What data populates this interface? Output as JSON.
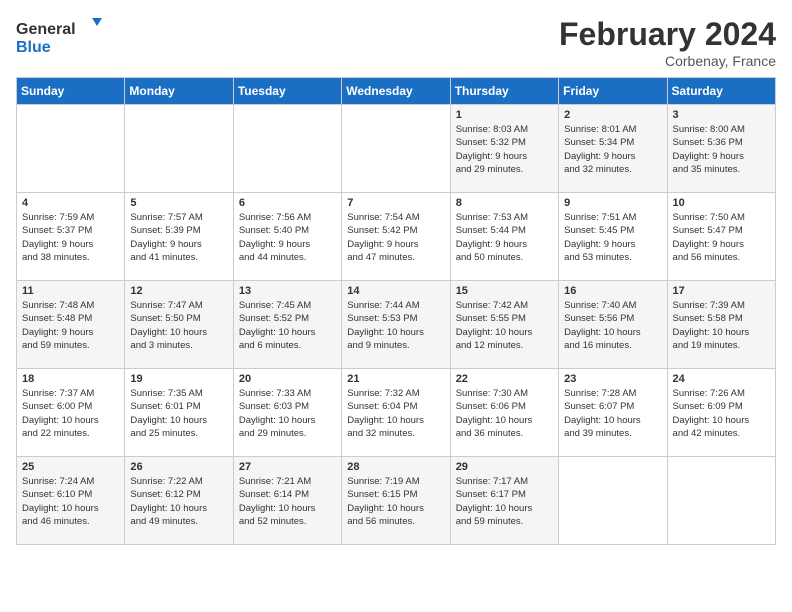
{
  "header": {
    "logo_general": "General",
    "logo_blue": "Blue",
    "month_title": "February 2024",
    "location": "Corbenay, France"
  },
  "days_of_week": [
    "Sunday",
    "Monday",
    "Tuesday",
    "Wednesday",
    "Thursday",
    "Friday",
    "Saturday"
  ],
  "weeks": [
    [
      {
        "day": "",
        "info": ""
      },
      {
        "day": "",
        "info": ""
      },
      {
        "day": "",
        "info": ""
      },
      {
        "day": "",
        "info": ""
      },
      {
        "day": "1",
        "info": "Sunrise: 8:03 AM\nSunset: 5:32 PM\nDaylight: 9 hours\nand 29 minutes."
      },
      {
        "day": "2",
        "info": "Sunrise: 8:01 AM\nSunset: 5:34 PM\nDaylight: 9 hours\nand 32 minutes."
      },
      {
        "day": "3",
        "info": "Sunrise: 8:00 AM\nSunset: 5:36 PM\nDaylight: 9 hours\nand 35 minutes."
      }
    ],
    [
      {
        "day": "4",
        "info": "Sunrise: 7:59 AM\nSunset: 5:37 PM\nDaylight: 9 hours\nand 38 minutes."
      },
      {
        "day": "5",
        "info": "Sunrise: 7:57 AM\nSunset: 5:39 PM\nDaylight: 9 hours\nand 41 minutes."
      },
      {
        "day": "6",
        "info": "Sunrise: 7:56 AM\nSunset: 5:40 PM\nDaylight: 9 hours\nand 44 minutes."
      },
      {
        "day": "7",
        "info": "Sunrise: 7:54 AM\nSunset: 5:42 PM\nDaylight: 9 hours\nand 47 minutes."
      },
      {
        "day": "8",
        "info": "Sunrise: 7:53 AM\nSunset: 5:44 PM\nDaylight: 9 hours\nand 50 minutes."
      },
      {
        "day": "9",
        "info": "Sunrise: 7:51 AM\nSunset: 5:45 PM\nDaylight: 9 hours\nand 53 minutes."
      },
      {
        "day": "10",
        "info": "Sunrise: 7:50 AM\nSunset: 5:47 PM\nDaylight: 9 hours\nand 56 minutes."
      }
    ],
    [
      {
        "day": "11",
        "info": "Sunrise: 7:48 AM\nSunset: 5:48 PM\nDaylight: 9 hours\nand 59 minutes."
      },
      {
        "day": "12",
        "info": "Sunrise: 7:47 AM\nSunset: 5:50 PM\nDaylight: 10 hours\nand 3 minutes."
      },
      {
        "day": "13",
        "info": "Sunrise: 7:45 AM\nSunset: 5:52 PM\nDaylight: 10 hours\nand 6 minutes."
      },
      {
        "day": "14",
        "info": "Sunrise: 7:44 AM\nSunset: 5:53 PM\nDaylight: 10 hours\nand 9 minutes."
      },
      {
        "day": "15",
        "info": "Sunrise: 7:42 AM\nSunset: 5:55 PM\nDaylight: 10 hours\nand 12 minutes."
      },
      {
        "day": "16",
        "info": "Sunrise: 7:40 AM\nSunset: 5:56 PM\nDaylight: 10 hours\nand 16 minutes."
      },
      {
        "day": "17",
        "info": "Sunrise: 7:39 AM\nSunset: 5:58 PM\nDaylight: 10 hours\nand 19 minutes."
      }
    ],
    [
      {
        "day": "18",
        "info": "Sunrise: 7:37 AM\nSunset: 6:00 PM\nDaylight: 10 hours\nand 22 minutes."
      },
      {
        "day": "19",
        "info": "Sunrise: 7:35 AM\nSunset: 6:01 PM\nDaylight: 10 hours\nand 25 minutes."
      },
      {
        "day": "20",
        "info": "Sunrise: 7:33 AM\nSunset: 6:03 PM\nDaylight: 10 hours\nand 29 minutes."
      },
      {
        "day": "21",
        "info": "Sunrise: 7:32 AM\nSunset: 6:04 PM\nDaylight: 10 hours\nand 32 minutes."
      },
      {
        "day": "22",
        "info": "Sunrise: 7:30 AM\nSunset: 6:06 PM\nDaylight: 10 hours\nand 36 minutes."
      },
      {
        "day": "23",
        "info": "Sunrise: 7:28 AM\nSunset: 6:07 PM\nDaylight: 10 hours\nand 39 minutes."
      },
      {
        "day": "24",
        "info": "Sunrise: 7:26 AM\nSunset: 6:09 PM\nDaylight: 10 hours\nand 42 minutes."
      }
    ],
    [
      {
        "day": "25",
        "info": "Sunrise: 7:24 AM\nSunset: 6:10 PM\nDaylight: 10 hours\nand 46 minutes."
      },
      {
        "day": "26",
        "info": "Sunrise: 7:22 AM\nSunset: 6:12 PM\nDaylight: 10 hours\nand 49 minutes."
      },
      {
        "day": "27",
        "info": "Sunrise: 7:21 AM\nSunset: 6:14 PM\nDaylight: 10 hours\nand 52 minutes."
      },
      {
        "day": "28",
        "info": "Sunrise: 7:19 AM\nSunset: 6:15 PM\nDaylight: 10 hours\nand 56 minutes."
      },
      {
        "day": "29",
        "info": "Sunrise: 7:17 AM\nSunset: 6:17 PM\nDaylight: 10 hours\nand 59 minutes."
      },
      {
        "day": "",
        "info": ""
      },
      {
        "day": "",
        "info": ""
      }
    ]
  ]
}
